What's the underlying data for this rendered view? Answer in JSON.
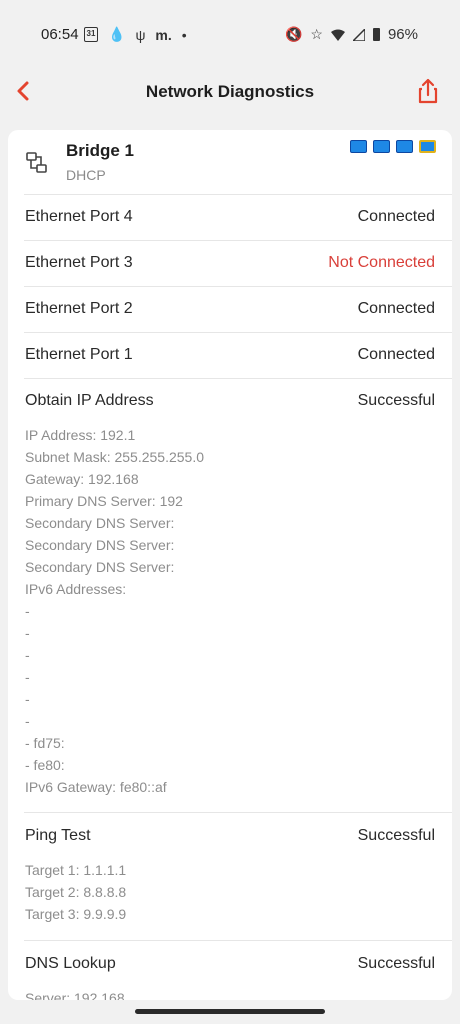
{
  "status_bar": {
    "time": "06:54",
    "calendar_day": "31",
    "carrier_glyph": "m.",
    "dot": "•",
    "battery_pct": "96%"
  },
  "header": {
    "title": "Network Diagnostics",
    "accent_color": "#e4442f"
  },
  "bridge": {
    "name": "Bridge 1",
    "mode": "DHCP",
    "port_led_color": "#1e88e5"
  },
  "ports": [
    {
      "label": "Ethernet Port 4",
      "status": "Connected"
    },
    {
      "label": "Ethernet Port 3",
      "status": "Not Connected"
    },
    {
      "label": "Ethernet Port 2",
      "status": "Connected"
    },
    {
      "label": "Ethernet Port 1",
      "status": "Connected"
    }
  ],
  "obtain_ip": {
    "label": "Obtain IP Address",
    "status": "Successful",
    "details": [
      "IP Address: 192.1",
      "Subnet Mask: 255.255.255.0",
      "Gateway: 192.168",
      "Primary DNS Server: 192",
      "Secondary DNS Server:",
      "Secondary DNS Server:",
      "Secondary DNS Server:",
      "IPv6 Addresses:",
      " - ",
      " - ",
      " - ",
      " - ",
      " - ",
      " - ",
      " - fd75:",
      " - fe80:",
      "IPv6 Gateway: fe80::af"
    ]
  },
  "ping": {
    "label": "Ping Test",
    "status": "Successful",
    "details": [
      "Target 1: 1.1.1.1",
      "Target 2: 8.8.8.8",
      "Target 3: 9.9.9.9"
    ]
  },
  "dns": {
    "label": "DNS Lookup",
    "status": "Successful",
    "details": [
      "Server: 192.168"
    ]
  }
}
